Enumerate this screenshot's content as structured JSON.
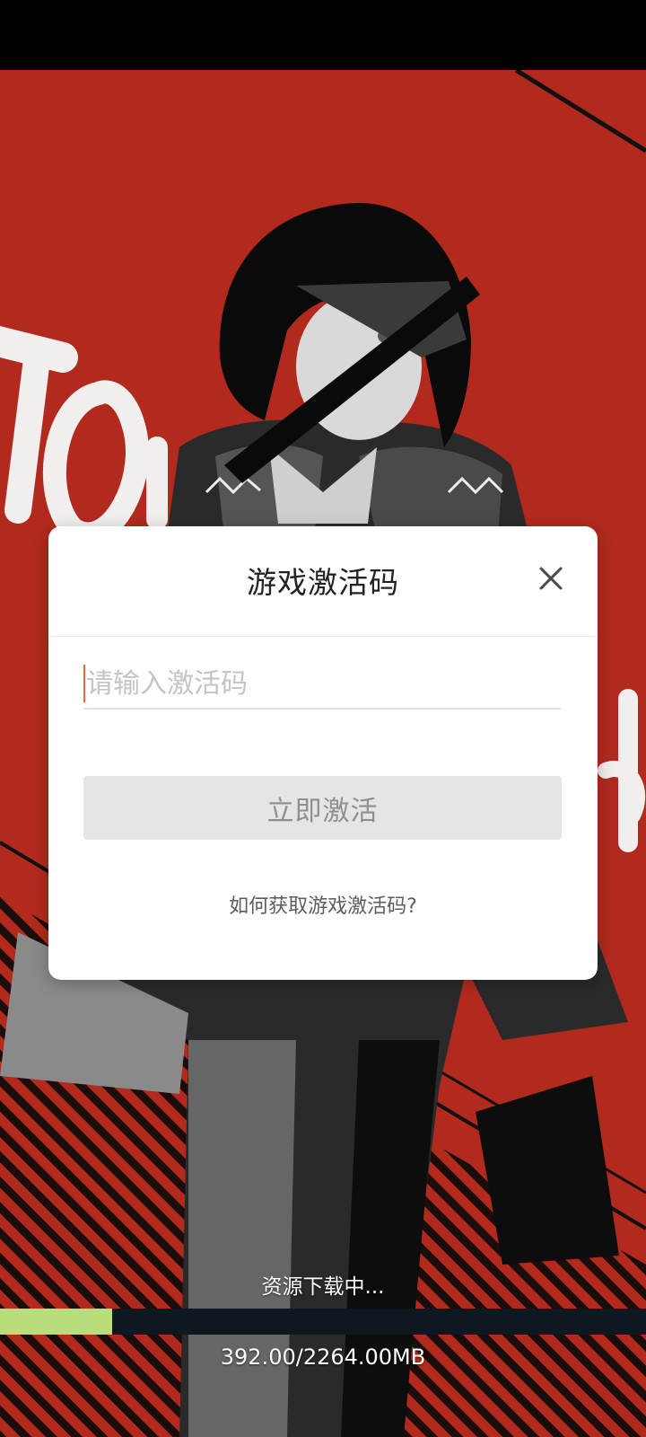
{
  "colors": {
    "background_red": "#b22a1e",
    "progress_fill": "#b9dc7d",
    "progress_track": "#0e1820",
    "caret": "#e06a3b"
  },
  "dialog": {
    "title": "游戏激活码",
    "close_icon": "close-icon",
    "input": {
      "placeholder": "请输入激活码",
      "value": ""
    },
    "activate_button": "立即激活",
    "help_link": "如何获取游戏激活码?"
  },
  "download": {
    "status": "资源下载中...",
    "progress": 0.1731,
    "size_text": "392.00/2264.00MB"
  }
}
